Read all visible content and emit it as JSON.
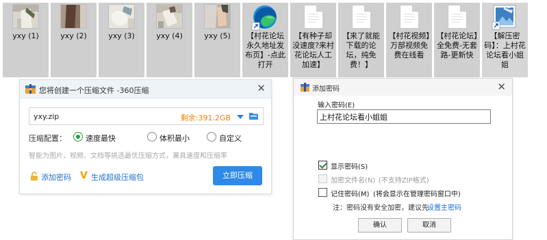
{
  "desktop": {
    "items": [
      {
        "label": "yxy (1)",
        "kind": "photo"
      },
      {
        "label": "yxy (2)",
        "kind": "photo"
      },
      {
        "label": "yxy (3)",
        "kind": "photo"
      },
      {
        "label": "yxy (4)",
        "kind": "photo"
      },
      {
        "label": "yxy (5)",
        "kind": "photo"
      },
      {
        "label": "【村花论坛永久地址发布页】-点此打开",
        "kind": "edge-shortcut"
      },
      {
        "label": "【有种子却没速度?来村花论坛人工加速】",
        "kind": "text-document"
      },
      {
        "label": "【来了就能下载的论坛，纯免费！】",
        "kind": "text-document"
      },
      {
        "label": "【村花视频】万部视频免费在线看",
        "kind": "text-document"
      },
      {
        "label": "【村花论坛】全免费-无套路-更新快",
        "kind": "text-document"
      },
      {
        "label": "【解压密码】：上村花论坛看小姐姐",
        "kind": "image-shortcut"
      }
    ]
  },
  "compress_window": {
    "title": "您将创建一个压缩文件 -360压缩",
    "file_name": "yxy.zip",
    "space_left": "剩余:391.2GB",
    "config_label": "压缩配置：",
    "options": [
      {
        "label": "速度最快",
        "selected": true
      },
      {
        "label": "体积最小",
        "selected": false
      },
      {
        "label": "自定义",
        "selected": false
      }
    ],
    "hint": "智能为图片、视频、文档等挑选最优压缩方式，兼具速度和压缩率",
    "add_password": "添加密码",
    "super_compress": "生成超级压缩包",
    "compress_button": "立即压缩",
    "accent_color": "#2e8ae6"
  },
  "password_dialog": {
    "title": "添加密码",
    "input_label": "输入密码(E)",
    "password_value": "上村花论坛看小姐姐",
    "show_password": "显示密码(S)",
    "show_password_checked": true,
    "encrypt_names": "加密文件名(N)",
    "encrypt_names_note": "(不支持ZIP格式)",
    "remember_password": "记住密码(M)",
    "remember_note": "(将会显示在管理密码窗口中)",
    "note_prefix": "注：密码没有安全加密，建议先",
    "note_link": "设置主密码",
    "ok_button": "确认",
    "cancel_button": "取消"
  }
}
